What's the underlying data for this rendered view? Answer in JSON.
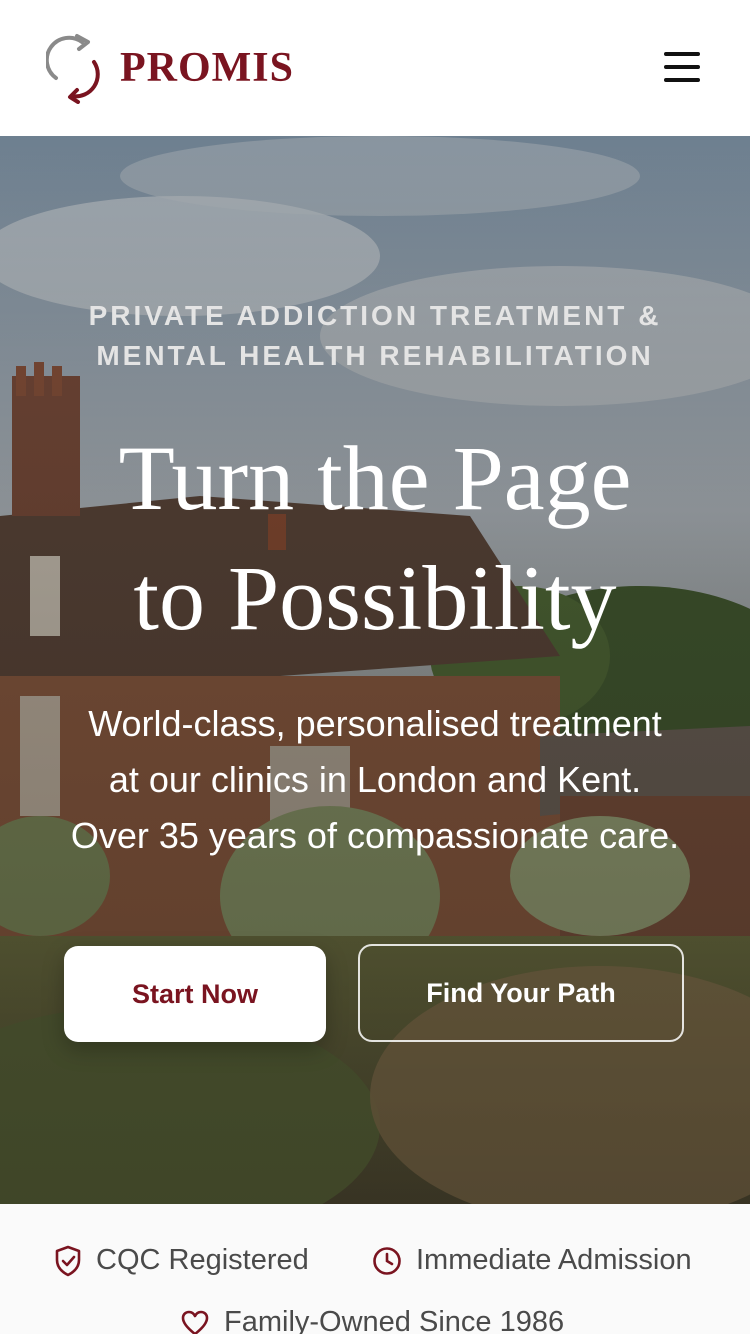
{
  "header": {
    "brand": "PROMIS",
    "brand_color": "#7a1420",
    "logo_icon": "circular-arrows-logo",
    "menu_icon": "hamburger-menu-icon"
  },
  "hero": {
    "kicker_line1": "PRIVATE ADDICTION TREATMENT &",
    "kicker_line2": "MENTAL HEALTH REHABILITATION",
    "headline_line1": "Turn the Page",
    "headline_line2": "to Possibility",
    "sub_line1": "World-class, personalised treatment",
    "sub_line2": "at our clinics in London and Kent.",
    "sub_line3": "Over 35 years of compassionate care.",
    "primary_cta": "Start Now",
    "secondary_cta": "Find Your Path"
  },
  "trust": {
    "items": [
      {
        "label": "CQC Registered",
        "icon": "shield-check-icon"
      },
      {
        "label": "Immediate Admission",
        "icon": "clock-icon"
      },
      {
        "label": "Family-Owned Since 1986",
        "icon": "heart-icon"
      }
    ],
    "icon_color": "#7a1420"
  }
}
